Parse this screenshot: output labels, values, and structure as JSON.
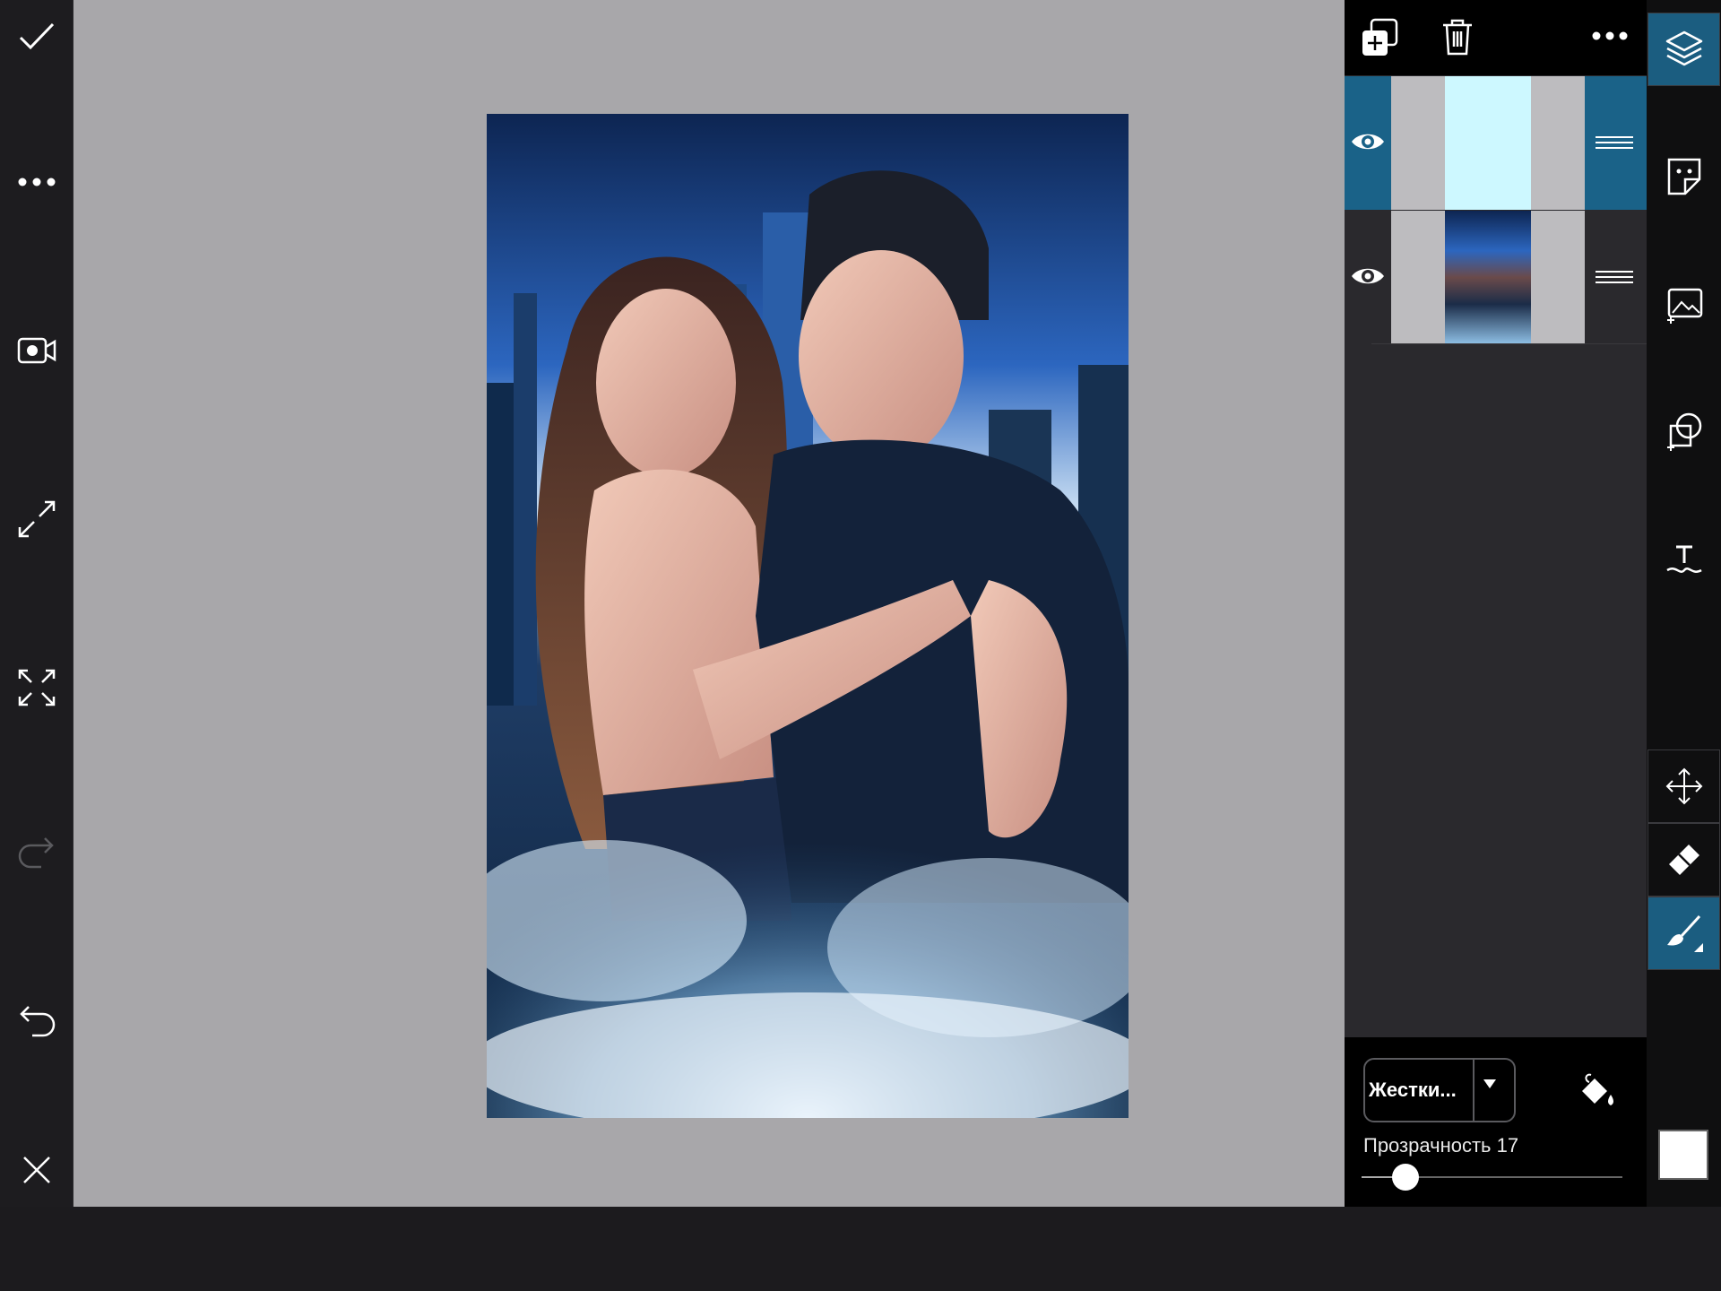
{
  "left_toolbar": {
    "icons": [
      "check-icon",
      "more-icon",
      "video-record-icon",
      "expand-icon",
      "fit-screen-icon",
      "redo-icon",
      "undo-icon",
      "close-icon"
    ]
  },
  "layers": {
    "toolbar_icons": [
      "add-layer-icon",
      "delete-layer-icon",
      "layers-more-icon"
    ],
    "items": [
      {
        "visible": true,
        "selected": true,
        "thumb_color": "#cdf8ff"
      },
      {
        "visible": true,
        "selected": false,
        "thumb_color": "photo"
      }
    ]
  },
  "blend": {
    "mode_label": "Жестки...",
    "opacity_label": "Прозрачность 17",
    "opacity_value": 17,
    "opacity_max": 100
  },
  "right_toolbar": {
    "icons": [
      "layers-icon",
      "sticker-icon",
      "add-photo-icon",
      "add-shape-icon",
      "text-icon",
      "move-icon",
      "eraser-icon",
      "brush-icon"
    ]
  },
  "colors": {
    "selected_layer": "#1a6288",
    "active_tool": "#1b5d80",
    "canvas_bg": "#a8a7aa",
    "current_color": "#ffffff"
  }
}
